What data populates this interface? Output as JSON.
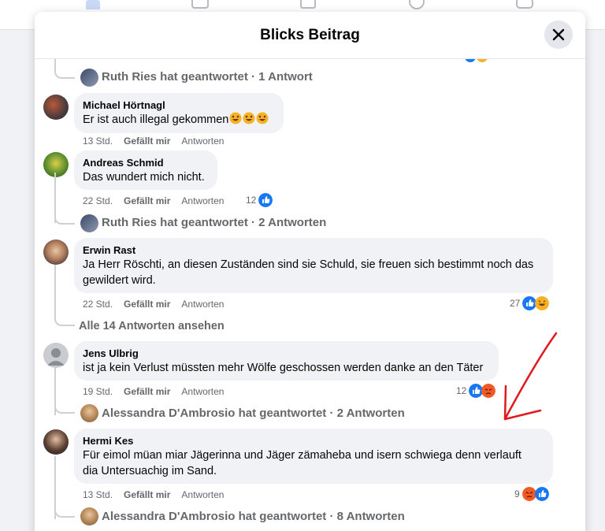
{
  "dialog": {
    "title": "Blicks Beitrag"
  },
  "threads": [
    {
      "replied_summary": "Ruth Ries hat geantwortet · 1 Antwort"
    },
    {
      "author": "Michael Hörtnagl",
      "text": "Er ist auch illegal gekommen",
      "time": "13 Std.",
      "like": "Gefällt mir",
      "reply": "Antworten"
    },
    {
      "author": "Andreas Schmid",
      "text": "Das wundert mich nicht.",
      "time": "22 Std.",
      "like": "Gefällt mir",
      "reply": "Antworten",
      "reaction_count": "12",
      "replied_summary": "Ruth Ries hat geantwortet · 2 Antworten"
    },
    {
      "author": "Erwin Rast",
      "text_line1": "Ja Herr Röschti, an diesen Zuständen sind sie Schuld, sie freuen sich bestimmt noch das",
      "text_line2": "gewildert wird.",
      "time": "22 Std.",
      "like": "Gefällt mir",
      "reply": "Antworten",
      "reaction_count": "27",
      "view_all": "Alle 14 Antworten ansehen"
    },
    {
      "author": "Jens Ulbrig",
      "text": "ist ja kein Verlust müssten mehr Wölfe geschossen werden danke an den Täter",
      "time": "19 Std.",
      "like": "Gefällt mir",
      "reply": "Antworten",
      "reaction_count": "12",
      "replied_summary": "Alessandra D'Ambrosio hat geantwortet · 2 Antworten"
    },
    {
      "author": "Hermi Kes",
      "text_line1": "Für eimol müan miar Jägerinna und Jäger zämaheba und isern schwiega denn verlauft",
      "text_line2": "dia Untersuachig im Sand.",
      "time": "13 Std.",
      "like": "Gefällt mir",
      "reply": "Antworten",
      "reaction_count": "9",
      "replied_summary": "Alessandra D'Ambrosio hat geantwortet · 8 Antworten"
    }
  ],
  "icons": {
    "close": "close-icon",
    "like": "like-reaction-icon",
    "haha": "haha-reaction-icon",
    "angry": "angry-reaction-icon",
    "annotation": "red-arrow-annotation"
  },
  "colors": {
    "like_blue": "#1877f2",
    "annotation_red": "#e0191e",
    "meta_gray": "#65676b",
    "bubble_bg": "#f0f2f5"
  }
}
